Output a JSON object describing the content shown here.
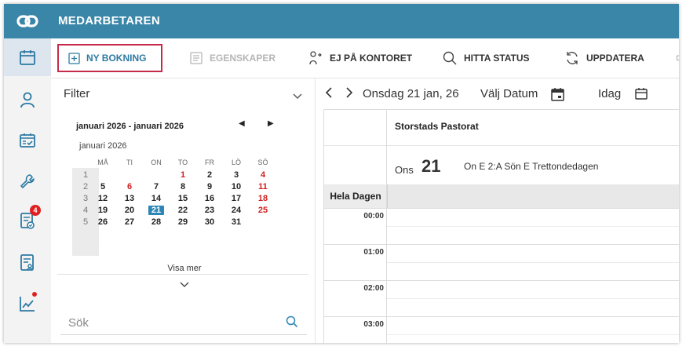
{
  "app": {
    "title": "MEDARBETAREN"
  },
  "rail": {
    "items": [
      {
        "name": "calendar",
        "active": true
      },
      {
        "name": "person"
      },
      {
        "name": "schedule"
      },
      {
        "name": "wrench"
      },
      {
        "name": "tasks",
        "badge": "4"
      },
      {
        "name": "report"
      },
      {
        "name": "chart",
        "dot": true
      }
    ]
  },
  "toolbar": {
    "new_booking": "NY BOKNING",
    "properties": "EGENSKAPER",
    "out_of_office": "EJ PÅ KONTORET",
    "find_status": "HITTA STATUS",
    "refresh": "UPPDATERA"
  },
  "filter": {
    "label": "Filter"
  },
  "mini_calendar": {
    "range": "januari 2026 - januari 2026",
    "month": "januari 2026",
    "weekdays": [
      "MÅ",
      "TI",
      "ON",
      "TO",
      "FR",
      "LÖ",
      "SÖ"
    ],
    "weeks": [
      {
        "wk": "1",
        "days": [
          "",
          "",
          "",
          "1",
          "2",
          "3",
          "4"
        ]
      },
      {
        "wk": "2",
        "days": [
          "5",
          "6",
          "7",
          "8",
          "9",
          "10",
          "11"
        ]
      },
      {
        "wk": "3",
        "days": [
          "12",
          "13",
          "14",
          "15",
          "16",
          "17",
          "18"
        ]
      },
      {
        "wk": "4",
        "days": [
          "19",
          "20",
          "21",
          "22",
          "23",
          "24",
          "25"
        ]
      },
      {
        "wk": "5",
        "days": [
          "26",
          "27",
          "28",
          "29",
          "30",
          "31",
          ""
        ]
      }
    ],
    "red_days": [
      "1",
      "4",
      "6",
      "11",
      "18",
      "25"
    ],
    "selected_day": "21",
    "show_more": "Visa mer",
    "selected_color": "#2d86b5",
    "holiday_color": "#d01f1f"
  },
  "search": {
    "placeholder": "Sök"
  },
  "nav": {
    "date": "Onsdag 21 jan, 26",
    "pick_date": "Välj Datum",
    "today": "Idag"
  },
  "day_view": {
    "resource": "Storstads Pastorat",
    "weekday": "Ons",
    "day_number": "21",
    "day_info": "On E 2:A Sön E Trettondedagen",
    "all_day": "Hela Dagen",
    "hours": [
      "00:00",
      "01:00",
      "02:00",
      "03:00"
    ]
  },
  "colors": {
    "topbar": "#3a86a8",
    "accent": "#2d7aa3",
    "highlight_border": "#c62a4a",
    "badge": "#e02020"
  }
}
